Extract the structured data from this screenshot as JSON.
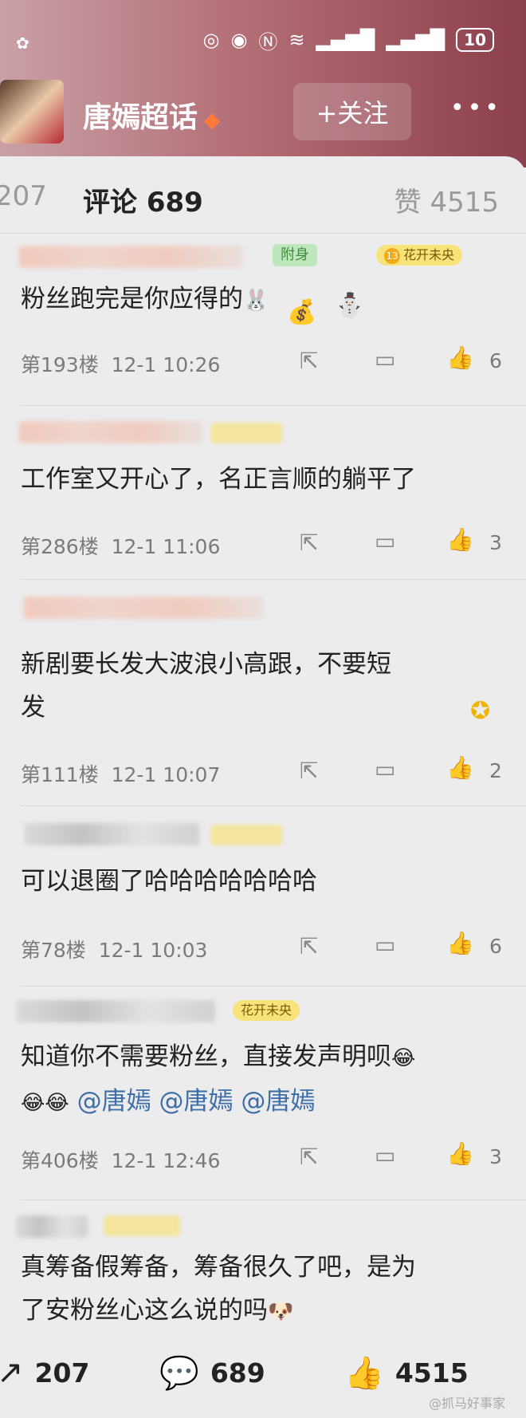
{
  "header": {
    "status": {
      "battery": "10",
      "icons": [
        "nfc-icon",
        "eye-icon",
        "n-icon",
        "wifi-icon",
        "signal-icon",
        "signal-icon"
      ]
    },
    "topic_title": "唐嫣超话",
    "follow_label": "+关注",
    "more_label": "•••"
  },
  "tabs": {
    "repost": "207",
    "comments": "评论 689",
    "likes": "赞 4515"
  },
  "comments": [
    {
      "badge": "附身",
      "level_badge": "花开未央",
      "level": "13",
      "text": "粉丝跑完是你应得的",
      "floor": "第193楼",
      "time": "12-1 10:26",
      "likes": "6"
    },
    {
      "text": "工作室又开心了，名正言顺的躺平了",
      "floor": "第286楼",
      "time": "12-1 11:06",
      "likes": "3"
    },
    {
      "text_line1": "新剧要长发大波浪小高跟，不要短",
      "text_line2": "发",
      "floor": "第111楼",
      "time": "12-1 10:07",
      "likes": "2"
    },
    {
      "text": "可以退圈了哈哈哈哈哈哈哈",
      "floor": "第78楼",
      "time": "12-1 10:03",
      "likes": "6"
    },
    {
      "level_badge": "花开未央",
      "text_line1": "知道你不需要粉丝，直接发声明呗",
      "mentions": [
        "@唐嫣",
        "@唐嫣",
        "@唐嫣"
      ],
      "floor": "第406楼",
      "time": "12-1 12:46",
      "likes": "3"
    },
    {
      "text_line1": "真筹备假筹备，筹备很久了吧，是为",
      "text_line2": "了安粉丝心这么说的吗"
    }
  ],
  "bottom_bar": {
    "repost_count": "207",
    "comment_count": "689",
    "like_count": "4515",
    "watermark": "@抓马好事家"
  },
  "colors": {
    "header_start": "#c9a0a6",
    "header_end": "#8c3f4c",
    "mention": "#3d6ea8",
    "background": "#ececed"
  }
}
